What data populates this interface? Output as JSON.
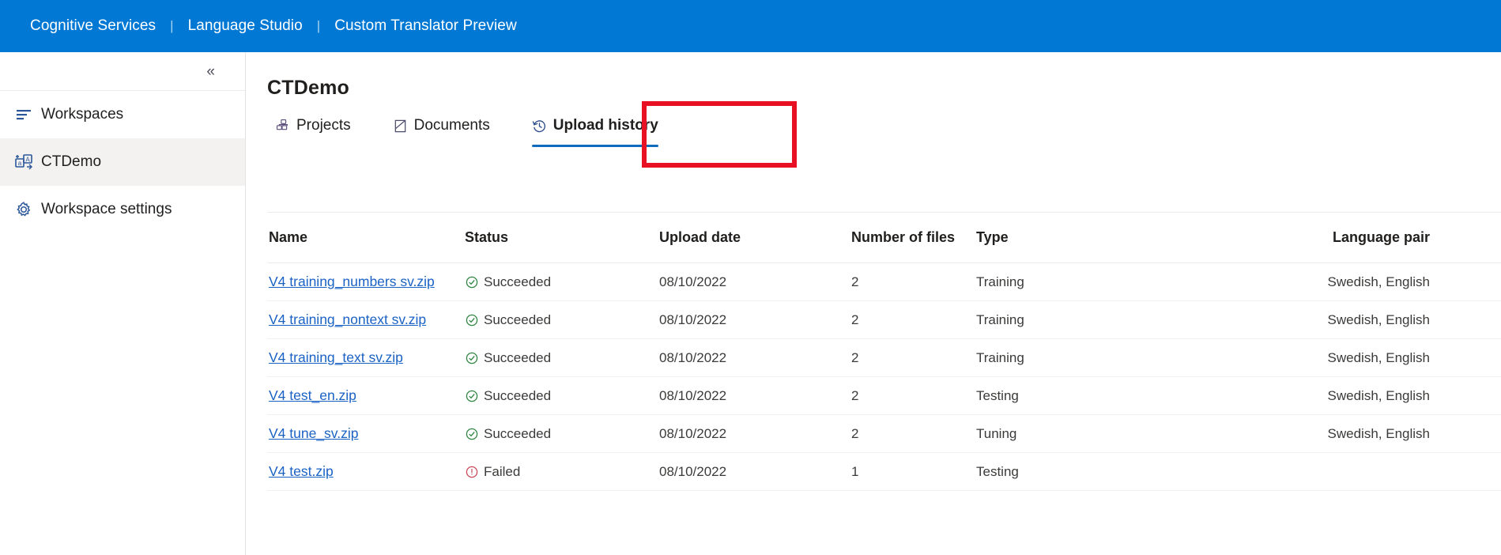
{
  "topbar": {
    "links": [
      {
        "label": "Cognitive Services",
        "name": "cognitive-services-link"
      },
      {
        "label": "Language Studio",
        "name": "language-studio-link"
      },
      {
        "label": "Custom Translator Preview",
        "name": "custom-translator-preview-link"
      }
    ],
    "separator": "|",
    "background_color": "#0078d4"
  },
  "sidebar": {
    "collapse_glyph": "«",
    "items": [
      {
        "label": "Workspaces",
        "icon": "list-icon",
        "selected": false
      },
      {
        "label": "CTDemo",
        "icon": "translate-icon",
        "selected": true
      },
      {
        "label": "Workspace settings",
        "icon": "gear-icon",
        "selected": false
      }
    ]
  },
  "main": {
    "title": "CTDemo",
    "tabs": [
      {
        "label": "Projects",
        "icon": "projects-icon",
        "active": false
      },
      {
        "label": "Documents",
        "icon": "documents-icon",
        "active": false
      },
      {
        "label": "Upload history",
        "icon": "history-icon",
        "active": true
      }
    ],
    "active_tab_accent": "#0f6cbd",
    "annotation_color": "#e81123",
    "table": {
      "columns": [
        "Name",
        "Status",
        "Upload date",
        "Number of files",
        "Type",
        "Language pair"
      ],
      "rows": [
        {
          "name": "V4 training_numbers sv.zip",
          "status": "Succeeded",
          "status_kind": "success",
          "upload_date": "08/10/2022",
          "number_of_files": "2",
          "type": "Training",
          "language_pair": "Swedish, English"
        },
        {
          "name": "V4 training_nontext sv.zip",
          "status": "Succeeded",
          "status_kind": "success",
          "upload_date": "08/10/2022",
          "number_of_files": "2",
          "type": "Training",
          "language_pair": "Swedish, English"
        },
        {
          "name": "V4 training_text sv.zip",
          "status": "Succeeded",
          "status_kind": "success",
          "upload_date": "08/10/2022",
          "number_of_files": "2",
          "type": "Training",
          "language_pair": "Swedish, English"
        },
        {
          "name": "V4 test_en.zip",
          "status": "Succeeded",
          "status_kind": "success",
          "upload_date": "08/10/2022",
          "number_of_files": "2",
          "type": "Testing",
          "language_pair": "Swedish, English"
        },
        {
          "name": "V4 tune_sv.zip",
          "status": "Succeeded",
          "status_kind": "success",
          "upload_date": "08/10/2022",
          "number_of_files": "2",
          "type": "Tuning",
          "language_pair": "Swedish, English"
        },
        {
          "name": "V4 test.zip",
          "status": "Failed",
          "status_kind": "error",
          "upload_date": "08/10/2022",
          "number_of_files": "1",
          "type": "Testing",
          "language_pair": ""
        }
      ],
      "status_success_color": "#2e8540",
      "status_error_color": "#c8485a",
      "link_color": "#1a62c4"
    }
  }
}
